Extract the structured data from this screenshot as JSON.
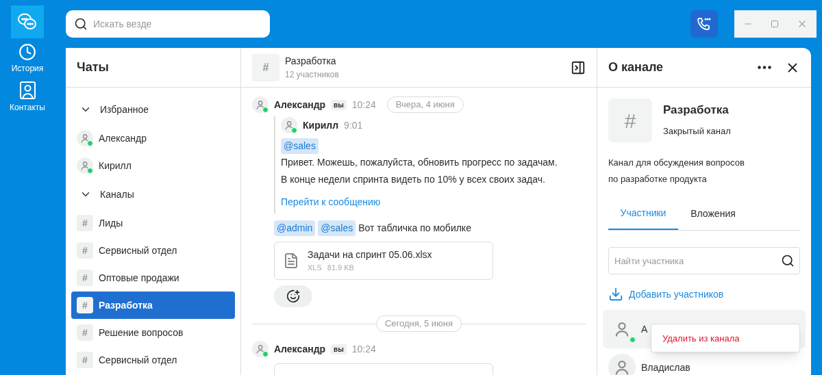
{
  "rail": [
    {
      "kind": "chats",
      "selected": true
    },
    {
      "kind": "history",
      "label": "История",
      "selected": false
    },
    {
      "kind": "contacts",
      "label": "Контакты",
      "selected": false
    }
  ],
  "search": {
    "placeholder": "Искать везде"
  },
  "chat_list": {
    "title": "Чаты",
    "sections": [
      {
        "title": "Избранное",
        "expanded": true,
        "items": [
          {
            "kind": "person",
            "name": "Александр",
            "online": true,
            "selected": false
          },
          {
            "kind": "person",
            "name": "Кирилл",
            "online": true,
            "selected": false
          }
        ]
      },
      {
        "title": "Каналы",
        "expanded": true,
        "items": [
          {
            "kind": "channel",
            "symbol": "#",
            "name": "Лиды",
            "selected": false
          },
          {
            "kind": "channel",
            "symbol": "#",
            "name": "Сервисный отдел",
            "selected": false
          },
          {
            "kind": "channel",
            "symbol": "#",
            "name": "Оптовые продажи",
            "selected": false
          },
          {
            "kind": "channel",
            "symbol": "#",
            "name": "Разработка",
            "selected": true
          },
          {
            "kind": "channel",
            "symbol": "#",
            "name": "Решение вопросов",
            "selected": false
          },
          {
            "kind": "channel",
            "symbol": "#",
            "name": "Сервисный отдел",
            "selected": false
          }
        ]
      }
    ]
  },
  "chat": {
    "symbol": "#",
    "title": "Разработка",
    "subtitle": "12 участников",
    "messages": [
      {
        "kind": "message",
        "author": "Александр",
        "badge": "вы",
        "time": "10:24",
        "online": true,
        "date": "Вчера, 4 июня",
        "quote": {
          "author": "Кирилл",
          "time": "9:01",
          "online": true,
          "mentions": [
            "@sales"
          ],
          "lines": [
            "Привет. Можешь, пожалуйста, обновить прогресс по задачам.",
            "В конце недели спринта видеть по 10% у всех своих задач."
          ],
          "link": "Перейти к сообщению"
        },
        "mentions": [
          "@admin",
          "@sales"
        ],
        "text": "Вот табличка по мобилке",
        "file": {
          "name": "Задачи на спринт 05.06.xlsx",
          "type": "XLS",
          "size": "81.9 KB"
        },
        "reaction_button": true
      },
      {
        "kind": "divider",
        "date": "Сегодня, 5 июня"
      },
      {
        "kind": "message",
        "author": "Александр",
        "badge": "вы",
        "time": "10:24",
        "online": true,
        "file_stub": true
      }
    ]
  },
  "info": {
    "title": "О канале",
    "symbol": "#",
    "name": "Разработка",
    "type": "Закрытый канал",
    "description": [
      "Канал для обсуждения вопросов",
      "по разработке продукта"
    ],
    "tabs": [
      {
        "label": "Участники",
        "selected": true
      },
      {
        "label": "Вложения",
        "selected": false
      }
    ],
    "member_search": {
      "placeholder": "Найти участника"
    },
    "add_link": "Добавить участников",
    "members": [
      {
        "name": "А",
        "online": true,
        "hovered": true
      },
      {
        "name": "Владислав",
        "hovered": false
      }
    ],
    "context_menu": [
      "Удалить из канала"
    ]
  }
}
